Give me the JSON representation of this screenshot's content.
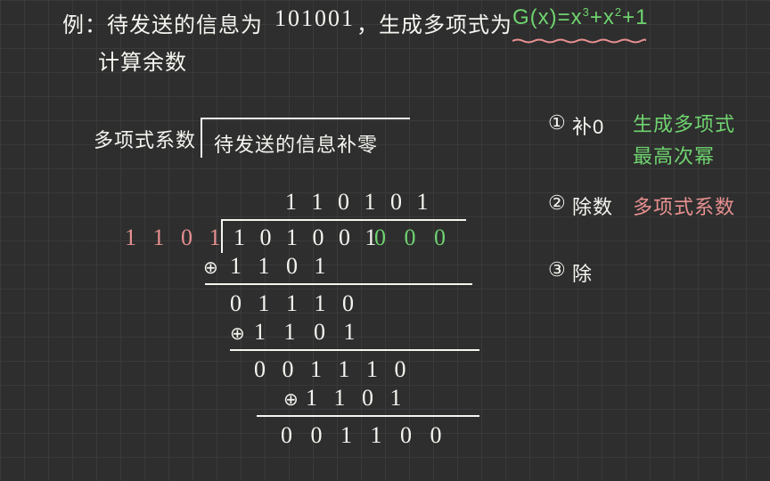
{
  "title_part1": "例：待发送的信息为",
  "title_bits": "101001",
  "title_part2": "，生成多项式为",
  "gx_label": "G(x)=x",
  "gx_exp1": "3",
  "gx_mid": "+x",
  "gx_exp2": "2",
  "gx_end": "+1",
  "subtitle": "计算余数",
  "div_label_left": "多项式系数",
  "div_label_right": "待发送的信息补零",
  "quotient": "1 1 0 1 0 1",
  "divisor": "1 1 0 1",
  "dividend_main": "1 0 1 0 0 1",
  "dividend_pad": "0 0 0",
  "row1_xor_sym": "⊕",
  "row1_xor": "1 1 0 1",
  "row2_res": "0 1 1 1 0",
  "row2_xor": "1 1  0 1",
  "row3_res": "0 0 1 1 1 0",
  "row3_xor": "1 1 0 1",
  "row4_res": "0 0 1 1 0 0",
  "step1_num": "①",
  "step1_label": "补0",
  "step1_note_a": "生成多项式",
  "step1_note_b": "最高次幂",
  "step2_num": "②",
  "step2_label": "除数",
  "step2_note": "多项式系数",
  "step3_num": "③",
  "step3_label": "除"
}
